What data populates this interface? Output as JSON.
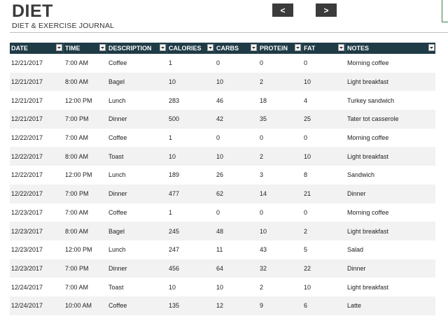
{
  "title": "DIET",
  "subtitle": "DIET & EXERCISE JOURNAL",
  "nav": {
    "prev_label": "<",
    "next_label": ">"
  },
  "columns": {
    "date": "DATE",
    "time": "TIME",
    "description": "DESCRIPTION",
    "calories": "CALORIES",
    "carbs": "CARBS",
    "protein": "PROTEIN",
    "fat": "FAT",
    "notes": "NOTES"
  },
  "icons": {
    "filter": "filter-dropdown-icon"
  },
  "colors": {
    "header_bg": "#1f3b46",
    "alt_row": "#f2f2f2",
    "nav_btn": "#3b3b3b"
  },
  "rows": [
    {
      "date": "12/21/2017",
      "time": "7:00 AM",
      "description": "Coffee",
      "calories": "1",
      "carbs": "0",
      "protein": "0",
      "fat": "0",
      "notes": "Morning coffee"
    },
    {
      "date": "12/21/2017",
      "time": "8:00 AM",
      "description": "Bagel",
      "calories": "10",
      "carbs": "10",
      "protein": "2",
      "fat": "10",
      "notes": "Light breakfast"
    },
    {
      "date": "12/21/2017",
      "time": "12:00 PM",
      "description": "Lunch",
      "calories": "283",
      "carbs": "46",
      "protein": "18",
      "fat": "4",
      "notes": "Turkey sandwich"
    },
    {
      "date": "12/21/2017",
      "time": "7:00 PM",
      "description": "Dinner",
      "calories": "500",
      "carbs": "42",
      "protein": "35",
      "fat": "25",
      "notes": "Tater tot casserole"
    },
    {
      "date": "12/22/2017",
      "time": "7:00 AM",
      "description": "Coffee",
      "calories": "1",
      "carbs": "0",
      "protein": "0",
      "fat": "0",
      "notes": "Morning coffee"
    },
    {
      "date": "12/22/2017",
      "time": "8:00 AM",
      "description": "Toast",
      "calories": "10",
      "carbs": "10",
      "protein": "2",
      "fat": "10",
      "notes": "Light breakfast"
    },
    {
      "date": "12/22/2017",
      "time": "12:00 PM",
      "description": "Lunch",
      "calories": "189",
      "carbs": "26",
      "protein": "3",
      "fat": "8",
      "notes": "Sandwich"
    },
    {
      "date": "12/22/2017",
      "time": "7:00 PM",
      "description": "Dinner",
      "calories": "477",
      "carbs": "62",
      "protein": "14",
      "fat": "21",
      "notes": "Dinner"
    },
    {
      "date": "12/23/2017",
      "time": "7:00 AM",
      "description": "Coffee",
      "calories": "1",
      "carbs": "0",
      "protein": "0",
      "fat": "0",
      "notes": "Morning coffee"
    },
    {
      "date": "12/23/2017",
      "time": "8:00 AM",
      "description": "Bagel",
      "calories": "245",
      "carbs": "48",
      "protein": "10",
      "fat": "2",
      "notes": "Light breakfast"
    },
    {
      "date": "12/23/2017",
      "time": "12:00 PM",
      "description": "Lunch",
      "calories": "247",
      "carbs": "11",
      "protein": "43",
      "fat": "5",
      "notes": "Salad"
    },
    {
      "date": "12/23/2017",
      "time": "7:00 PM",
      "description": "Dinner",
      "calories": "456",
      "carbs": "64",
      "protein": "32",
      "fat": "22",
      "notes": "Dinner"
    },
    {
      "date": "12/24/2017",
      "time": "7:00 AM",
      "description": "Toast",
      "calories": "10",
      "carbs": "10",
      "protein": "2",
      "fat": "10",
      "notes": "Light breakfast"
    },
    {
      "date": "12/24/2017",
      "time": "10:00 AM",
      "description": "Coffee",
      "calories": "135",
      "carbs": "12",
      "protein": "9",
      "fat": "6",
      "notes": "Latte"
    }
  ]
}
